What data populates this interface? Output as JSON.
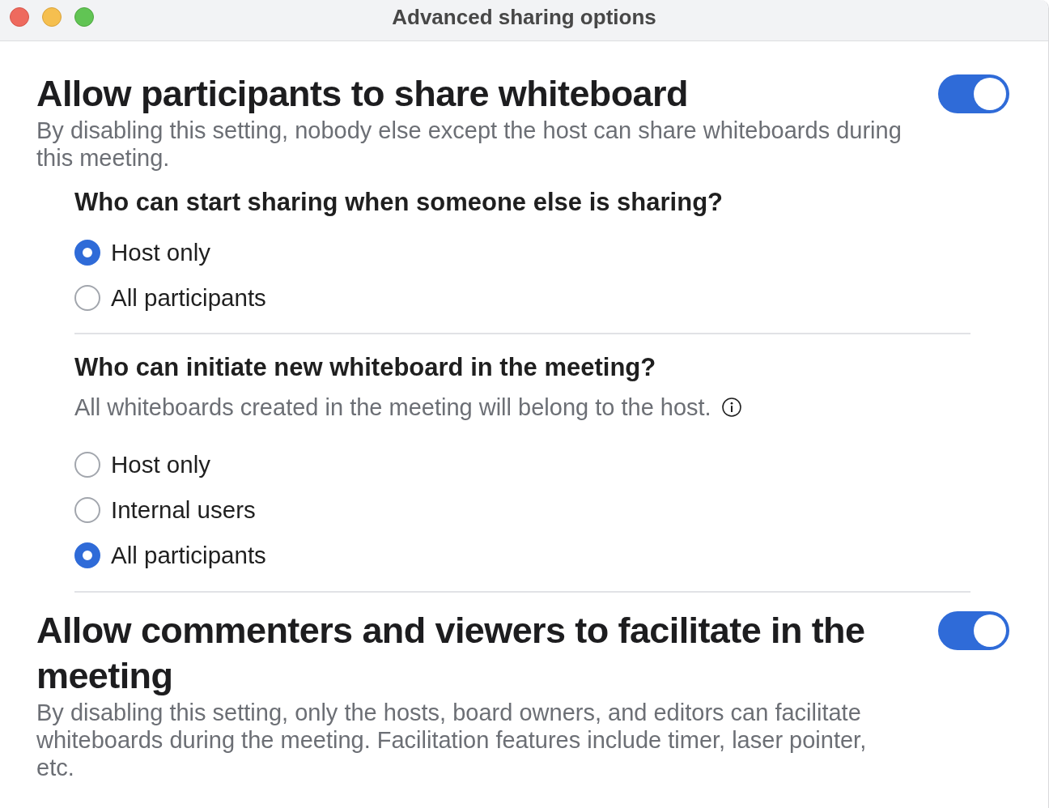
{
  "window": {
    "title": "Advanced sharing options"
  },
  "sections": [
    {
      "title": "Allow participants to share whiteboard",
      "description": "By disabling this setting, nobody else except the host can share whiteboards during this meeting.",
      "on": true,
      "questions": [
        {
          "question": "Who can start sharing when someone else is sharing?",
          "options": [
            {
              "label": "Host only",
              "selected": true
            },
            {
              "label": "All participants",
              "selected": false
            }
          ]
        },
        {
          "question": "Who can initiate new whiteboard in the meeting?",
          "note": "All whiteboards created in the meeting will belong to the host.",
          "options": [
            {
              "label": "Host only",
              "selected": false
            },
            {
              "label": "Internal users",
              "selected": false
            },
            {
              "label": "All participants",
              "selected": true
            }
          ]
        }
      ]
    },
    {
      "title": "Allow commenters and viewers to facilitate in the meeting",
      "description": "By disabling this setting, only the hosts, board owners, and editors can facilitate whiteboards during the meeting. Facilitation features include timer, laser pointer, etc.",
      "on": true
    }
  ]
}
